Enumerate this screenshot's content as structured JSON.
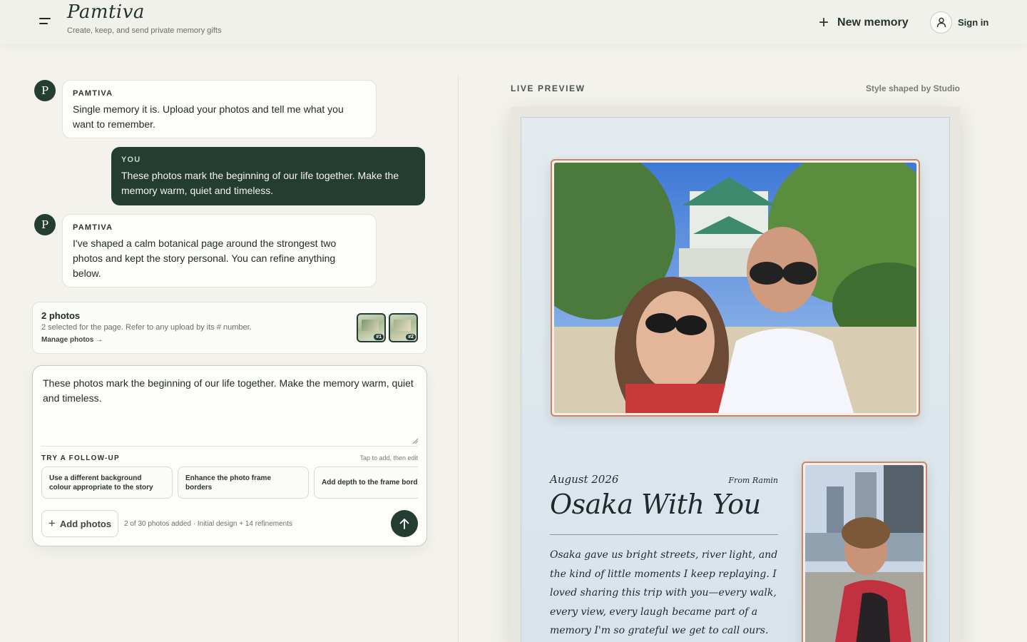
{
  "header": {
    "logo": "Pamtiva",
    "tagline": "Create, keep, and send private memory gifts",
    "new_memory_label": "New memory",
    "sign_in_label": "Sign in"
  },
  "chat": {
    "messages": [
      {
        "sender": "PAMTIVA",
        "avatar_letter": "P",
        "text": "Single memory it is. Upload your photos and tell me what you want to remember."
      },
      {
        "sender": "YOU",
        "text": "These photos mark the beginning of our life together. Make the memory warm, quiet and timeless."
      },
      {
        "sender": "PAMTIVA",
        "avatar_letter": "P",
        "text": "I've shaped a calm botanical page around the strongest two photos and kept the story personal. You can refine anything below."
      }
    ]
  },
  "photos_card": {
    "title": "2 photos",
    "subtitle": "2 selected for the page. Refer to any upload by its # number.",
    "manage_label": "Manage photos →",
    "thumbs": [
      {
        "tag": "#1"
      },
      {
        "tag": "#2"
      }
    ]
  },
  "composer": {
    "value": "These photos mark the beginning of our life together. Make the memory warm, quiet and timeless.",
    "follow_up_title": "TRY A FOLLOW-UP",
    "follow_up_hint": "Tap to add, then edit",
    "suggestions": [
      {
        "line1": "Use a different background",
        "line2": "colour appropriate to the story"
      },
      {
        "line1": "Enhance the photo frame",
        "line2": "borders"
      },
      {
        "line1": "Add depth to the frame borders",
        "line2": ""
      }
    ],
    "add_photos_label": "Add photos",
    "count_text": "2 of 30 photos added · Initial design + 14 refinements"
  },
  "preview": {
    "label": "LIVE PREVIEW",
    "style_label": "Style shaped by Studio",
    "date": "August 2026",
    "from": "From Ramin",
    "title": "Osaka With You",
    "story": "Osaka gave us bright streets, river light, and the kind of little moments I keep replaying. I loved sharing this trip with you—every walk, every view, every laugh became part of a memory I'm so grateful we get to call ours."
  },
  "colors": {
    "primary": "#243d33",
    "background": "#f3f2ec",
    "frame_accent": "#c48866",
    "preview_bg": "#dde6ec"
  }
}
